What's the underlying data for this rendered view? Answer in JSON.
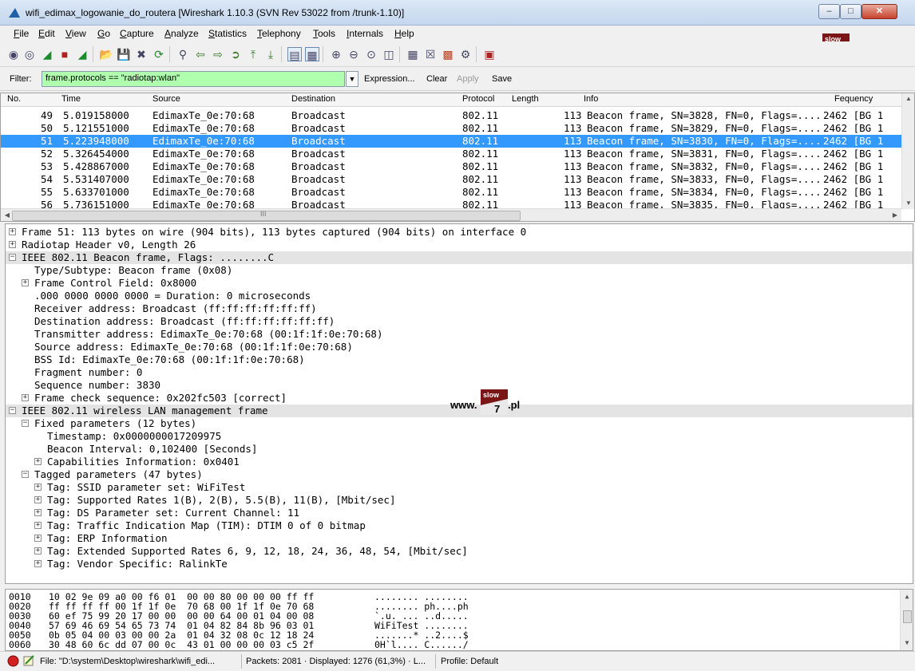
{
  "window": {
    "title": "wifi_edimax_logowanie_do_routera  [Wireshark 1.10.3  (SVN Rev 53022 from /trunk-1.10)]"
  },
  "menu": [
    "File",
    "Edit",
    "View",
    "Go",
    "Capture",
    "Analyze",
    "Statistics",
    "Telephony",
    "Tools",
    "Internals",
    "Help"
  ],
  "logo": {
    "prefix": "www.",
    "badge_top": "slow",
    "badge_num": "7",
    "suffix": ".pl"
  },
  "filter": {
    "label": "Filter:",
    "value": "frame.protocols == \"radiotap:wlan\"",
    "expression": "Expression...",
    "clear": "Clear",
    "apply": "Apply",
    "save": "Save"
  },
  "packet_list": {
    "columns": [
      "No.",
      "Time",
      "Source",
      "Destination",
      "Protocol",
      "Length",
      "Info",
      "Fequency"
    ],
    "rows": [
      {
        "no": "49",
        "time": "5.019158000",
        "src": "EdimaxTe_0e:70:68",
        "dst": "Broadcast",
        "proto": "802.11",
        "len": "113",
        "info": "Beacon frame, SN=3828, FN=0, Flags=....",
        "freq": "2462 [BG 1"
      },
      {
        "no": "50",
        "time": "5.121551000",
        "src": "EdimaxTe_0e:70:68",
        "dst": "Broadcast",
        "proto": "802.11",
        "len": "113",
        "info": "Beacon frame, SN=3829, FN=0, Flags=....",
        "freq": "2462 [BG 1"
      },
      {
        "no": "51",
        "time": "5.223948000",
        "src": "EdimaxTe_0e:70:68",
        "dst": "Broadcast",
        "proto": "802.11",
        "len": "113",
        "info": "Beacon frame, SN=3830, FN=0, Flags=....",
        "freq": "2462 [BG 1"
      },
      {
        "no": "52",
        "time": "5.326454000",
        "src": "EdimaxTe_0e:70:68",
        "dst": "Broadcast",
        "proto": "802.11",
        "len": "113",
        "info": "Beacon frame, SN=3831, FN=0, Flags=....",
        "freq": "2462 [BG 1"
      },
      {
        "no": "53",
        "time": "5.428867000",
        "src": "EdimaxTe_0e:70:68",
        "dst": "Broadcast",
        "proto": "802.11",
        "len": "113",
        "info": "Beacon frame, SN=3832, FN=0, Flags=....",
        "freq": "2462 [BG 1"
      },
      {
        "no": "54",
        "time": "5.531407000",
        "src": "EdimaxTe_0e:70:68",
        "dst": "Broadcast",
        "proto": "802.11",
        "len": "113",
        "info": "Beacon frame, SN=3833, FN=0, Flags=....",
        "freq": "2462 [BG 1"
      },
      {
        "no": "55",
        "time": "5.633701000",
        "src": "EdimaxTe_0e:70:68",
        "dst": "Broadcast",
        "proto": "802.11",
        "len": "113",
        "info": "Beacon frame, SN=3834, FN=0, Flags=....",
        "freq": "2462 [BG 1"
      },
      {
        "no": "56",
        "time": "5.736151000",
        "src": "EdimaxTe_0e:70:68",
        "dst": "Broadcast",
        "proto": "802.11",
        "len": "113",
        "info": "Beacon frame, SN=3835, FN=0, Flags=....",
        "freq": "2462 [BG 1"
      }
    ],
    "selected_no": "51",
    "hscroll_mark": "III"
  },
  "details": [
    {
      "indent": 0,
      "toggle": "+",
      "hl": false,
      "text": "Frame 51: 113 bytes on wire (904 bits), 113 bytes captured (904 bits) on interface 0"
    },
    {
      "indent": 0,
      "toggle": "+",
      "hl": false,
      "text": "Radiotap Header v0, Length 26"
    },
    {
      "indent": 0,
      "toggle": "-",
      "hl": true,
      "text": "IEEE 802.11 Beacon frame, Flags: ........C"
    },
    {
      "indent": 1,
      "toggle": "",
      "hl": false,
      "text": "Type/Subtype: Beacon frame (0x08)"
    },
    {
      "indent": 1,
      "toggle": "+",
      "hl": false,
      "text": "Frame Control Field: 0x8000"
    },
    {
      "indent": 1,
      "toggle": "",
      "hl": false,
      "text": ".000 0000 0000 0000 = Duration: 0 microseconds"
    },
    {
      "indent": 1,
      "toggle": "",
      "hl": false,
      "text": "Receiver address: Broadcast (ff:ff:ff:ff:ff:ff)"
    },
    {
      "indent": 1,
      "toggle": "",
      "hl": false,
      "text": "Destination address: Broadcast (ff:ff:ff:ff:ff:ff)"
    },
    {
      "indent": 1,
      "toggle": "",
      "hl": false,
      "text": "Transmitter address: EdimaxTe_0e:70:68 (00:1f:1f:0e:70:68)"
    },
    {
      "indent": 1,
      "toggle": "",
      "hl": false,
      "text": "Source address: EdimaxTe_0e:70:68 (00:1f:1f:0e:70:68)"
    },
    {
      "indent": 1,
      "toggle": "",
      "hl": false,
      "text": "BSS Id: EdimaxTe_0e:70:68 (00:1f:1f:0e:70:68)"
    },
    {
      "indent": 1,
      "toggle": "",
      "hl": false,
      "text": "Fragment number: 0"
    },
    {
      "indent": 1,
      "toggle": "",
      "hl": false,
      "text": "Sequence number: 3830"
    },
    {
      "indent": 1,
      "toggle": "+",
      "hl": false,
      "text": "Frame check sequence: 0x202fc503 [correct]"
    },
    {
      "indent": 0,
      "toggle": "-",
      "hl": true,
      "text": "IEEE 802.11 wireless LAN management frame"
    },
    {
      "indent": 1,
      "toggle": "-",
      "hl": false,
      "text": "Fixed parameters (12 bytes)"
    },
    {
      "indent": 2,
      "toggle": "",
      "hl": false,
      "text": "Timestamp: 0x0000000017209975"
    },
    {
      "indent": 2,
      "toggle": "",
      "hl": false,
      "text": "Beacon Interval: 0,102400 [Seconds]"
    },
    {
      "indent": 2,
      "toggle": "+",
      "hl": false,
      "text": "Capabilities Information: 0x0401"
    },
    {
      "indent": 1,
      "toggle": "-",
      "hl": false,
      "text": "Tagged parameters (47 bytes)"
    },
    {
      "indent": 2,
      "toggle": "+",
      "hl": false,
      "text": "Tag: SSID parameter set: WiFiTest"
    },
    {
      "indent": 2,
      "toggle": "+",
      "hl": false,
      "text": "Tag: Supported Rates 1(B), 2(B), 5.5(B), 11(B), [Mbit/sec]"
    },
    {
      "indent": 2,
      "toggle": "+",
      "hl": false,
      "text": "Tag: DS Parameter set: Current Channel: 11"
    },
    {
      "indent": 2,
      "toggle": "+",
      "hl": false,
      "text": "Tag: Traffic Indication Map (TIM): DTIM 0 of 0 bitmap"
    },
    {
      "indent": 2,
      "toggle": "+",
      "hl": false,
      "text": "Tag: ERP Information"
    },
    {
      "indent": 2,
      "toggle": "+",
      "hl": false,
      "text": "Tag: Extended Supported Rates 6, 9, 12, 18, 24, 36, 48, 54, [Mbit/sec]"
    },
    {
      "indent": 2,
      "toggle": "+",
      "hl": false,
      "text": "Tag: Vendor Specific: RalinkTe"
    }
  ],
  "hex": [
    {
      "off": "0010",
      "bytes": "10 02 9e 09 a0 00 f6 01  00 00 80 00 00 00 ff ff",
      "ascii": "........ ........"
    },
    {
      "off": "0020",
      "bytes": "ff ff ff ff 00 1f 1f 0e  70 68 00 1f 1f 0e 70 68",
      "ascii": "........ ph....ph"
    },
    {
      "off": "0030",
      "bytes": "60 ef 75 99 20 17 00 00  00 00 64 00 01 04 00 08",
      "ascii": "`.u. ... ..d....."
    },
    {
      "off": "0040",
      "bytes": "57 69 46 69 54 65 73 74  01 04 82 84 8b 96 03 01",
      "ascii": "WiFiTest ........"
    },
    {
      "off": "0050",
      "bytes": "0b 05 04 00 03 00 00 2a  01 04 32 08 0c 12 18 24",
      "ascii": ".......* ..2....$"
    },
    {
      "off": "0060",
      "bytes": "30 48 60 6c dd 07 00 0c  43 01 00 00 00 03 c5 2f",
      "ascii": "0H`l.... C....../"
    }
  ],
  "status": {
    "file": "File: \"D:\\system\\Desktop\\wireshark\\wifi_edi...",
    "packets": "Packets: 2081 · Displayed: 1276 (61,3%)  · L...",
    "profile": "Profile: Default"
  },
  "colors": {
    "selection": "#3399ff",
    "filter_ok": "#afffaf",
    "tree_highlight": "#e4e4e4"
  }
}
